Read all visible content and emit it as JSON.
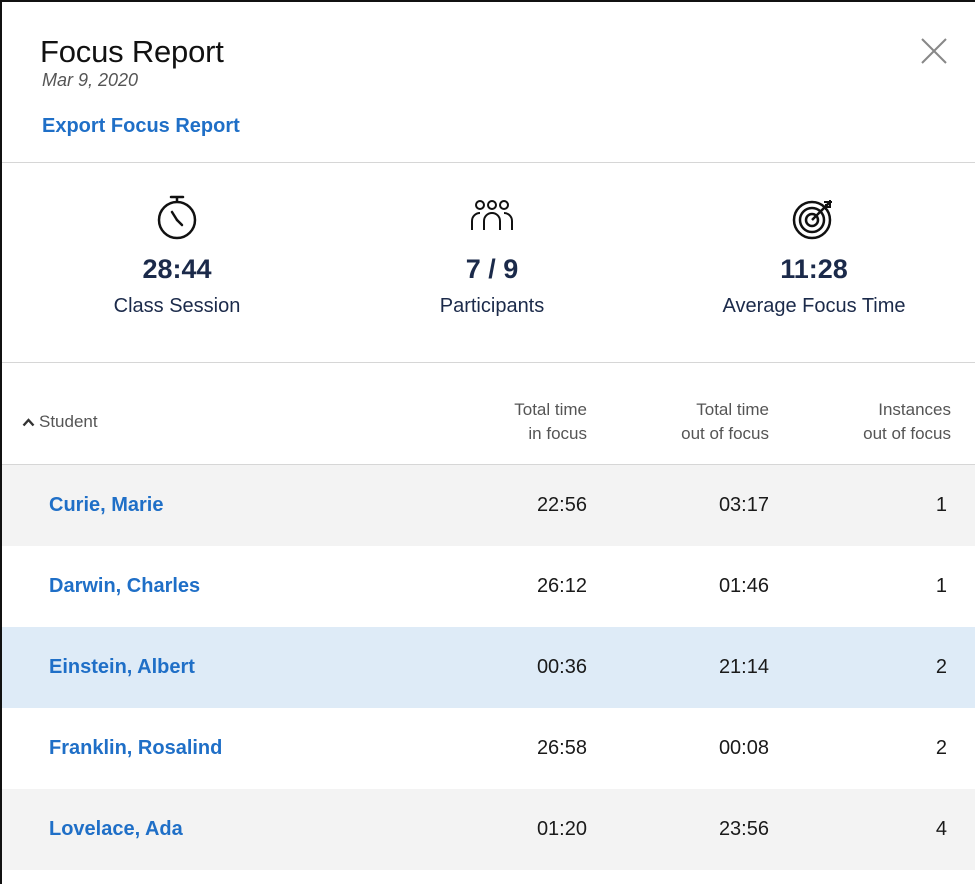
{
  "header": {
    "title": "Focus Report",
    "date": "Mar 9, 2020",
    "export_label": "Export Focus Report"
  },
  "stats": [
    {
      "icon": "stopwatch-icon",
      "value": "28:44",
      "label": "Class Session"
    },
    {
      "icon": "participants-icon",
      "value": "7 / 9",
      "label": "Participants"
    },
    {
      "icon": "target-icon",
      "value": "11:28",
      "label": "Average Focus Time"
    }
  ],
  "table": {
    "columns": {
      "student": "Student",
      "in_focus_line1": "Total time",
      "in_focus_line2": "in focus",
      "out_focus_line1": "Total time",
      "out_focus_line2": "out of focus",
      "instances_line1": "Instances",
      "instances_line2": "out of focus"
    },
    "sort_icon": "chevron-up-icon",
    "rows": [
      {
        "name": "Curie, Marie",
        "in_focus": "22:56",
        "out_focus": "03:17",
        "instances": "1"
      },
      {
        "name": "Darwin, Charles",
        "in_focus": "26:12",
        "out_focus": "01:46",
        "instances": "1"
      },
      {
        "name": "Einstein, Albert",
        "in_focus": "00:36",
        "out_focus": "21:14",
        "instances": "2"
      },
      {
        "name": "Franklin, Rosalind",
        "in_focus": "26:58",
        "out_focus": "00:08",
        "instances": "2"
      },
      {
        "name": "Lovelace, Ada",
        "in_focus": "01:20",
        "out_focus": "23:56",
        "instances": "4"
      }
    ]
  },
  "colors": {
    "link": "#1f6fc7",
    "stat_text": "#1b2a4a",
    "row_alt": "#f3f3f3",
    "row_selected": "#deebf7"
  }
}
